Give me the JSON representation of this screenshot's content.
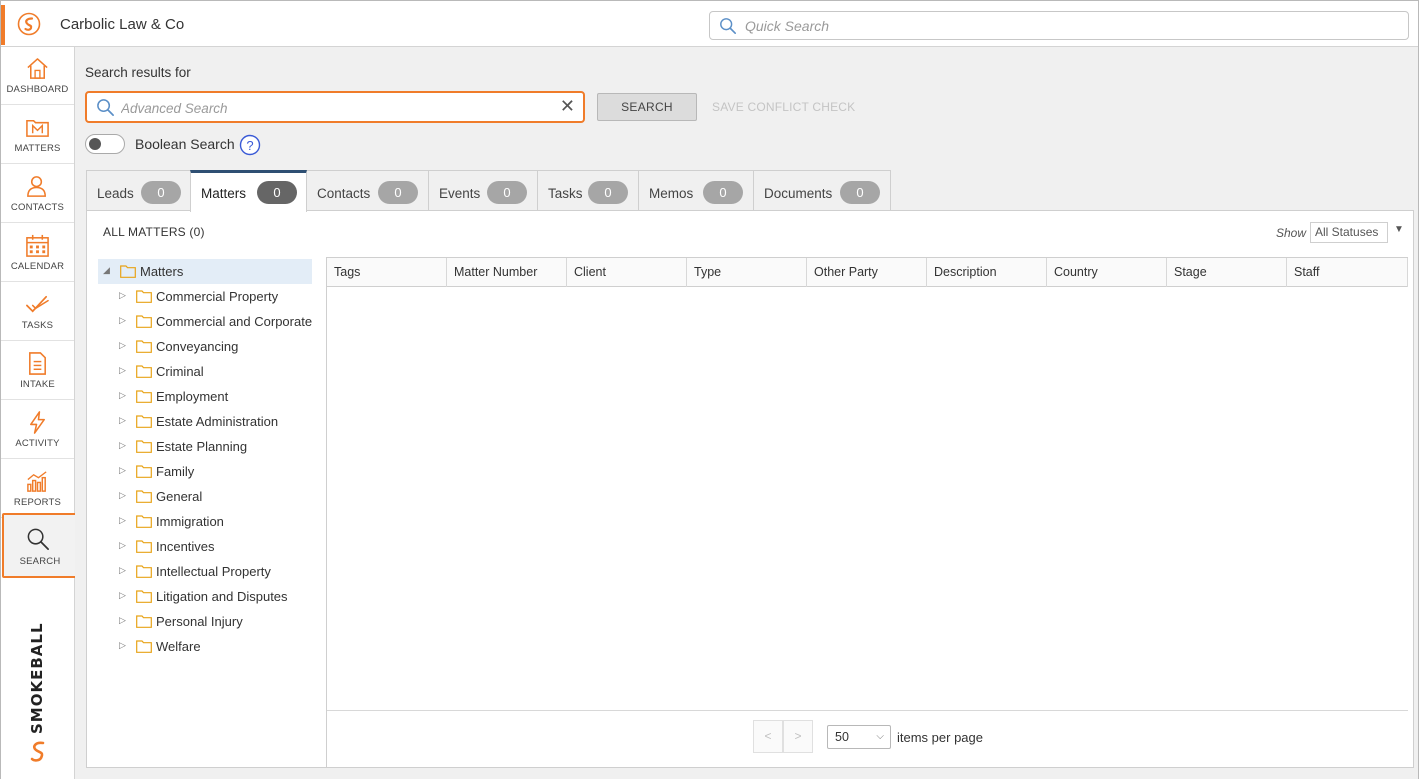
{
  "app": {
    "firm_name": "Carbolic Law & Co",
    "accent_color": "#f07c2a"
  },
  "quick_search": {
    "placeholder": "Quick Search",
    "value": ""
  },
  "sidenav": {
    "items": [
      {
        "label": "DASHBOARD",
        "icon": "home-icon"
      },
      {
        "label": "MATTERS",
        "icon": "matters-icon"
      },
      {
        "label": "CONTACTS",
        "icon": "contacts-icon"
      },
      {
        "label": "CALENDAR",
        "icon": "calendar-icon"
      },
      {
        "label": "TASKS",
        "icon": "tasks-icon"
      },
      {
        "label": "INTAKE",
        "icon": "intake-icon"
      },
      {
        "label": "ACTIVITY",
        "icon": "activity-icon"
      },
      {
        "label": "REPORTS",
        "icon": "reports-icon"
      },
      {
        "label": "SEARCH",
        "icon": "search-icon",
        "active": true
      }
    ],
    "brand": "SMOKEBALL"
  },
  "search": {
    "title": "Search results for",
    "advanced_placeholder": "Advanced Search",
    "advanced_value": "",
    "clear_glyph": "✕",
    "search_button": "SEARCH",
    "save_conflict_button": "SAVE CONFLICT CHECK",
    "boolean_label": "Boolean Search",
    "boolean_enabled": false,
    "help_glyph": "?"
  },
  "tabs": [
    {
      "label": "Leads",
      "count": "0"
    },
    {
      "label": "Matters",
      "count": "0",
      "active": true
    },
    {
      "label": "Contacts",
      "count": "0"
    },
    {
      "label": "Events",
      "count": "0"
    },
    {
      "label": "Tasks",
      "count": "0"
    },
    {
      "label": "Memos",
      "count": "0"
    },
    {
      "label": "Documents",
      "count": "0"
    }
  ],
  "matters_panel": {
    "heading": "ALL MATTERS (0)",
    "show_label": "Show",
    "status_filter": "All Statuses",
    "status_caret": "▼",
    "tree": {
      "root": {
        "label": "Matters",
        "caret": "◢"
      },
      "children": [
        "Commercial Property",
        "Commercial and Corporate",
        "Conveyancing",
        "Criminal",
        "Employment",
        "Estate Administration",
        "Estate Planning",
        "Family",
        "General",
        "Immigration",
        "Incentives",
        "Intellectual Property",
        "Litigation and Disputes",
        "Personal Injury",
        "Welfare"
      ],
      "child_caret": "▷"
    },
    "grid": {
      "columns": [
        "Tags",
        "Matter Number",
        "Client",
        "Type",
        "Other Party",
        "Description",
        "Country",
        "Stage",
        "Staff"
      ],
      "rows": []
    },
    "pager": {
      "prev_glyph": "<",
      "next_glyph": ">",
      "per_page": "50",
      "per_page_caret": "⌵",
      "per_page_label": "items per page"
    }
  }
}
